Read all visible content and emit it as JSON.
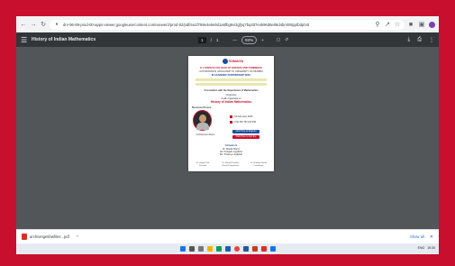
{
  "browser": {
    "url": "drv-96-99-prod-00-apps-viewer.googleusercontent.com/viewer2/prod-02/pdf/ea1f769e4e6e9d1a6fbg6vi3gfyq7bq4tt7e4k96d6e06d4bmh8tjq4bdp04t"
  },
  "pdf": {
    "menu_icon": "menu-icon",
    "title": "History of Indian Mathematics",
    "page_current": "1",
    "page_sep": "/",
    "page_total": "1",
    "zoom_minus": "—",
    "zoom": "93%",
    "zoom_plus": "+"
  },
  "poster": {
    "logo": "SOMAIYA",
    "lines": [
      "K J SOMAIYA COLLEGE OF SCIENCE AND COMMERCE",
      "AUTONOMOUS, AFFILIATED TO UNIVERSITY OF MUMBAI",
      "IN ACADEMIC PARTNERSHIP WITH",
      "Association with the Department of Mathematics",
      "Organizes",
      "A talk organised on",
      "History of Indian Mathematics"
    ],
    "speaker_label": "Resource Person",
    "date": "19 February 2024",
    "time": "3:00 PM Till 4:00 PM",
    "venue_label": "Conference Room",
    "btn_register": "Click Here to Register",
    "btn_join": "Click Here to Join the Session",
    "convenor_label": "Convenors",
    "convenors": [
      "Dr. Maulik Mistry",
      "Mr. Prakash Jogdand",
      "Ms. Pradnya Joglekar"
    ],
    "footer": [
      "Dr. Gayatri Patil",
      "Principal",
      "Dr. Sheetal Pasalkar",
      "Head of Department",
      "Dr. Pradnya Shinde",
      "Coordinator"
    ]
  },
  "download": {
    "filename": "archiveIgetifasfiles...pdf",
    "caret": "^",
    "show_all": "Show all",
    "close": "✕"
  },
  "taskbar": {
    "tray_lang": "ENG",
    "tray_time": "15:30"
  }
}
